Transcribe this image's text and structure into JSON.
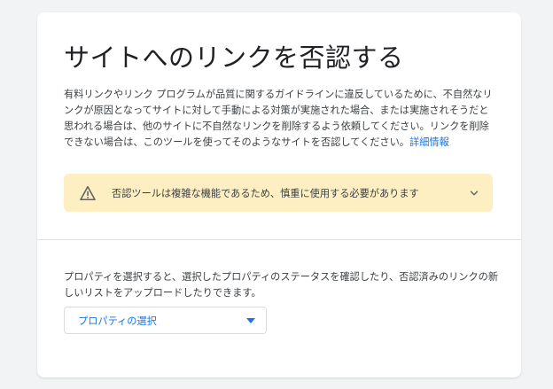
{
  "page": {
    "title": "サイトへのリンクを否認する",
    "description": "有料リンクやリンク プログラムが品質に関するガイドラインに違反しているために、不自然なリンクが原因となってサイトに対して手動による対策が実施された場合、または実施されそうだと思われる場合は、他のサイトに不自然なリンクを削除するよう依頼してください。リンクを削除できない場合は、このツールを使ってそのようなサイトを否認してください。",
    "learn_more_link": "詳細情報"
  },
  "warning": {
    "icon": "warning-icon",
    "text": "否認ツールは複雑な機能であるため、慎重に使用する必要があります",
    "expand_icon": "chevron-down-icon",
    "background_color": "#feefc3"
  },
  "property": {
    "instructions": "プロパティを選択すると、選択したプロパティのステータスを確認したり、否認済みのリンクの新しいリストをアップロードしたりできます。",
    "select_label": "プロパティの選択",
    "dropdown_icon": "dropdown-arrow-icon"
  },
  "colors": {
    "accent": "#1a73e8",
    "background": "#f1f3f4",
    "card": "#ffffff",
    "text": "#3c4043",
    "title": "#202124"
  }
}
